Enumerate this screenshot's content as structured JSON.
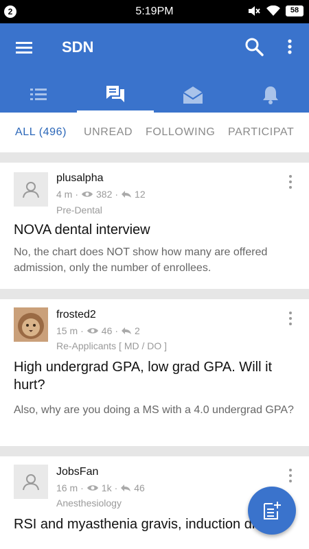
{
  "status_bar": {
    "notif_count": "2",
    "time": "5:19PM",
    "battery": "58"
  },
  "app": {
    "title": "SDN"
  },
  "filters": [
    {
      "label": "ALL (496)"
    },
    {
      "label": "UNREAD"
    },
    {
      "label": "FOLLOWING"
    },
    {
      "label": "PARTICIPAT"
    }
  ],
  "posts": [
    {
      "username": "plusalpha",
      "time": "4 m",
      "views": "382",
      "replies": "12",
      "forum": "Pre-Dental",
      "title": "NOVA dental interview",
      "excerpt": "No, the chart does NOT show how many are offered admission, only the number of enrollees."
    },
    {
      "username": "frosted2",
      "time": "15 m",
      "views": "46",
      "replies": "2",
      "forum": "Re-Applicants [ MD / DO ]",
      "title": "High undergrad GPA, low grad GPA. Will it hurt?",
      "excerpt": "Also, why are you doing a MS with a 4.0 undergrad GPA?"
    },
    {
      "username": "JobsFan",
      "time": "16 m",
      "views": "1k",
      "replies": "46",
      "forum": "Anesthesiology",
      "title": "RSI and myasthenia gravis, induction drugs?",
      "excerpt": ""
    }
  ],
  "colors": {
    "primary": "#3a73cc",
    "active_filter": "#2a66b8"
  }
}
